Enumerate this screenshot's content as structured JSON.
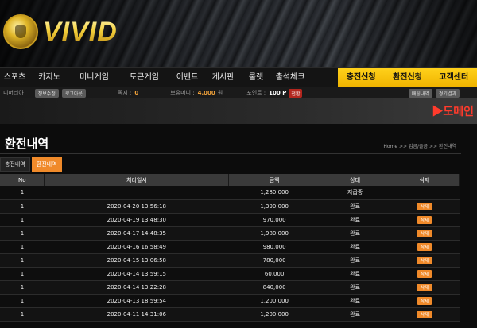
{
  "brand": {
    "name": "VIVID"
  },
  "nav": {
    "left": [
      "스포츠",
      "카지노",
      "미니게임",
      "토큰게임",
      "이벤트",
      "게시판",
      "룰렛",
      "출석체크"
    ],
    "right": [
      "충전신청",
      "환전신청",
      "고객센터"
    ]
  },
  "info": {
    "user": "디머리아",
    "btn_info": "정보수정",
    "btn_logout": "로그아웃",
    "letter_label": "쪽지 :",
    "letter_value": "0",
    "balance_label": "보유머니 :",
    "balance_value": "4,000",
    "balance_unit": "원",
    "point_label": "포인트 :",
    "point_value": "100 P",
    "point_btn": "전환",
    "btn_bet": "배팅내역",
    "btn_result": "경기결과"
  },
  "domain_label": "▶도메인",
  "page": {
    "title": "환전내역",
    "breadcrumb": "Home >> 입금/출금 >> 환전내역"
  },
  "tabs": [
    "충전내역",
    "환전내역"
  ],
  "table": {
    "headers": [
      "No",
      "처리일시",
      "금액",
      "상태",
      "삭제"
    ],
    "delete_label": "삭제",
    "rows": [
      {
        "no": "1",
        "date": "",
        "amount": "1,280,000",
        "status": "지급중",
        "del": false
      },
      {
        "no": "1",
        "date": "2020-04-20 13:56:18",
        "amount": "1,390,000",
        "status": "완료",
        "del": true
      },
      {
        "no": "1",
        "date": "2020-04-19 13:48:30",
        "amount": "970,000",
        "status": "완료",
        "del": true
      },
      {
        "no": "1",
        "date": "2020-04-17 14:48:35",
        "amount": "1,980,000",
        "status": "완료",
        "del": true
      },
      {
        "no": "1",
        "date": "2020-04-16 16:58:49",
        "amount": "980,000",
        "status": "완료",
        "del": true
      },
      {
        "no": "1",
        "date": "2020-04-15 13:06:58",
        "amount": "780,000",
        "status": "완료",
        "del": true
      },
      {
        "no": "1",
        "date": "2020-04-14 13:59:15",
        "amount": "60,000",
        "status": "완료",
        "del": true
      },
      {
        "no": "1",
        "date": "2020-04-14 13:22:28",
        "amount": "840,000",
        "status": "완료",
        "del": true
      },
      {
        "no": "1",
        "date": "2020-04-13 18:59:54",
        "amount": "1,200,000",
        "status": "완료",
        "del": true
      },
      {
        "no": "1",
        "date": "2020-04-11 14:31:06",
        "amount": "1,200,000",
        "status": "완료",
        "del": true
      }
    ]
  },
  "colors": {
    "accent": "#f08a2a",
    "nav_highlight": "#ffd21c",
    "domain_red": "#ff3b2c"
  }
}
